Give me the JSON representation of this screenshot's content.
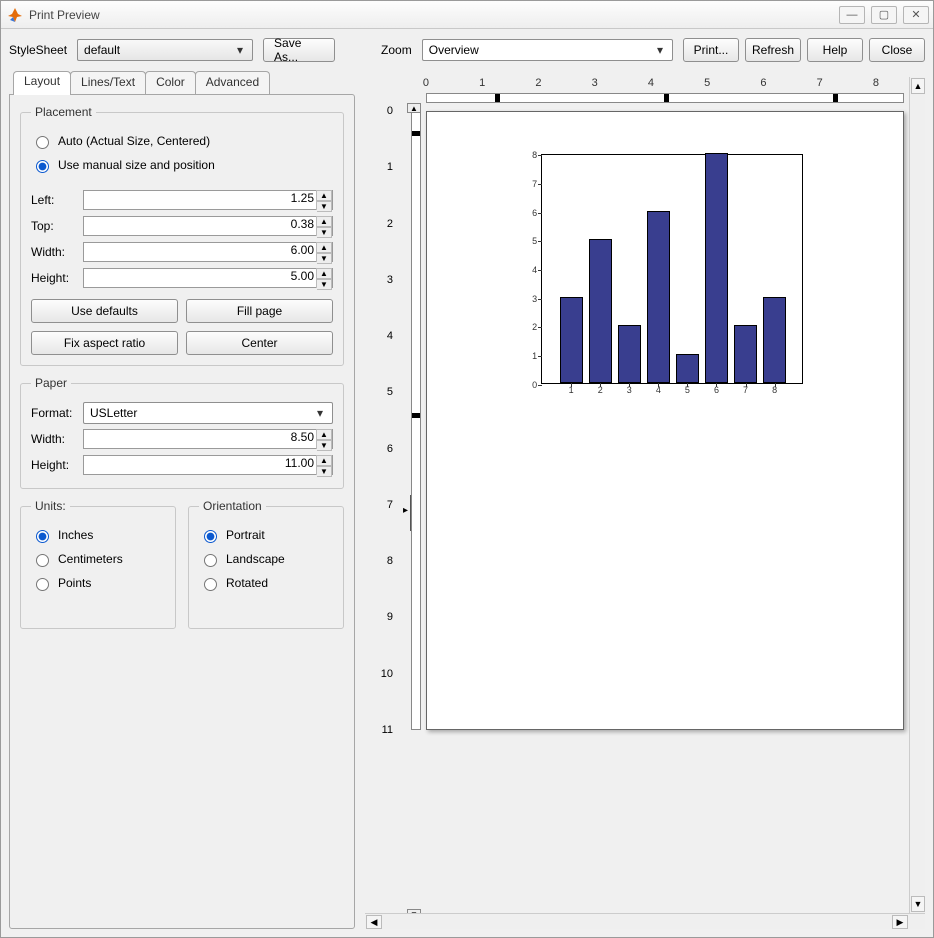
{
  "window": {
    "title": "Print Preview"
  },
  "header": {
    "stylesheet_label": "StyleSheet",
    "stylesheet_value": "default",
    "save_as_label": "Save As...",
    "zoom_label": "Zoom",
    "zoom_value": "Overview",
    "btn_print": "Print...",
    "btn_refresh": "Refresh",
    "btn_help": "Help",
    "btn_close": "Close"
  },
  "tabs": {
    "layout": "Layout",
    "lines": "Lines/Text",
    "color": "Color",
    "advanced": "Advanced"
  },
  "placement": {
    "legend": "Placement",
    "auto": "Auto (Actual Size, Centered)",
    "manual": "Use manual size and position",
    "left_label": "Left:",
    "left": "1.25",
    "top_label": "Top:",
    "top": "0.38",
    "width_label": "Width:",
    "width": "6.00",
    "height_label": "Height:",
    "height": "5.00",
    "use_defaults": "Use defaults",
    "fill_page": "Fill page",
    "fix_aspect": "Fix aspect ratio",
    "center": "Center"
  },
  "paper": {
    "legend": "Paper",
    "format_label": "Format:",
    "format": "USLetter",
    "width_label": "Width:",
    "width": "8.50",
    "height_label": "Height:",
    "height": "11.00"
  },
  "units": {
    "legend": "Units:",
    "inches": "Inches",
    "centimeters": "Centimeters",
    "points": "Points"
  },
  "orientation": {
    "legend": "Orientation",
    "portrait": "Portrait",
    "landscape": "Landscape",
    "rotated": "Rotated"
  },
  "hruler_ticks": [
    "0",
    "1",
    "2",
    "3",
    "4",
    "5",
    "6",
    "7",
    "8"
  ],
  "vruler_ticks": [
    "0",
    "1",
    "2",
    "3",
    "4",
    "5",
    "6",
    "7",
    "8",
    "9",
    "10",
    "11"
  ],
  "chart_data": {
    "type": "bar",
    "categories": [
      "1",
      "2",
      "3",
      "4",
      "5",
      "6",
      "7",
      "8"
    ],
    "values": [
      3,
      5,
      2,
      6,
      1,
      8,
      2,
      3
    ],
    "xlabel": "",
    "ylabel": "",
    "ylim": [
      0,
      8
    ],
    "xlim": [
      0,
      9
    ],
    "ytick": [
      0,
      1,
      2,
      3,
      4,
      5,
      6,
      7,
      8
    ],
    "bar_color": "#393e8f"
  }
}
